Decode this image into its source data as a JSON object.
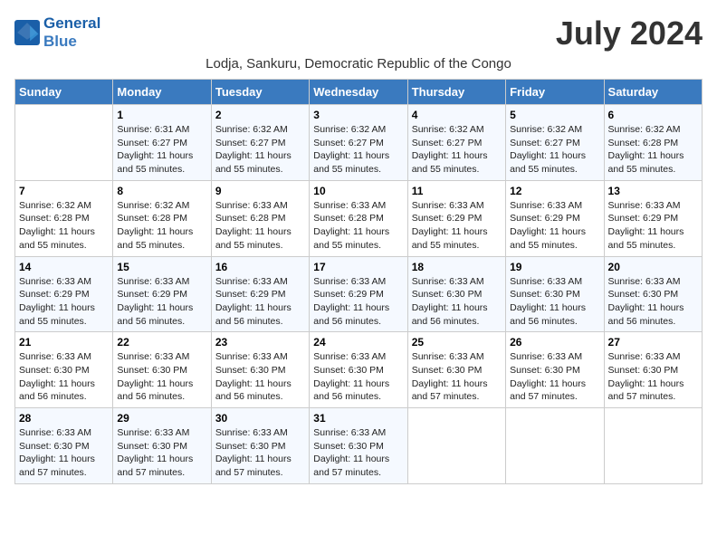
{
  "logo": {
    "line1": "General",
    "line2": "Blue"
  },
  "title": "July 2024",
  "location": "Lodja, Sankuru, Democratic Republic of the Congo",
  "days_of_week": [
    "Sunday",
    "Monday",
    "Tuesday",
    "Wednesday",
    "Thursday",
    "Friday",
    "Saturday"
  ],
  "weeks": [
    [
      {
        "day": "",
        "sunrise": "",
        "sunset": "",
        "daylight": ""
      },
      {
        "day": "1",
        "sunrise": "Sunrise: 6:31 AM",
        "sunset": "Sunset: 6:27 PM",
        "daylight": "Daylight: 11 hours and 55 minutes."
      },
      {
        "day": "2",
        "sunrise": "Sunrise: 6:32 AM",
        "sunset": "Sunset: 6:27 PM",
        "daylight": "Daylight: 11 hours and 55 minutes."
      },
      {
        "day": "3",
        "sunrise": "Sunrise: 6:32 AM",
        "sunset": "Sunset: 6:27 PM",
        "daylight": "Daylight: 11 hours and 55 minutes."
      },
      {
        "day": "4",
        "sunrise": "Sunrise: 6:32 AM",
        "sunset": "Sunset: 6:27 PM",
        "daylight": "Daylight: 11 hours and 55 minutes."
      },
      {
        "day": "5",
        "sunrise": "Sunrise: 6:32 AM",
        "sunset": "Sunset: 6:27 PM",
        "daylight": "Daylight: 11 hours and 55 minutes."
      },
      {
        "day": "6",
        "sunrise": "Sunrise: 6:32 AM",
        "sunset": "Sunset: 6:28 PM",
        "daylight": "Daylight: 11 hours and 55 minutes."
      }
    ],
    [
      {
        "day": "7",
        "sunrise": "Sunrise: 6:32 AM",
        "sunset": "Sunset: 6:28 PM",
        "daylight": "Daylight: 11 hours and 55 minutes."
      },
      {
        "day": "8",
        "sunrise": "Sunrise: 6:32 AM",
        "sunset": "Sunset: 6:28 PM",
        "daylight": "Daylight: 11 hours and 55 minutes."
      },
      {
        "day": "9",
        "sunrise": "Sunrise: 6:33 AM",
        "sunset": "Sunset: 6:28 PM",
        "daylight": "Daylight: 11 hours and 55 minutes."
      },
      {
        "day": "10",
        "sunrise": "Sunrise: 6:33 AM",
        "sunset": "Sunset: 6:28 PM",
        "daylight": "Daylight: 11 hours and 55 minutes."
      },
      {
        "day": "11",
        "sunrise": "Sunrise: 6:33 AM",
        "sunset": "Sunset: 6:29 PM",
        "daylight": "Daylight: 11 hours and 55 minutes."
      },
      {
        "day": "12",
        "sunrise": "Sunrise: 6:33 AM",
        "sunset": "Sunset: 6:29 PM",
        "daylight": "Daylight: 11 hours and 55 minutes."
      },
      {
        "day": "13",
        "sunrise": "Sunrise: 6:33 AM",
        "sunset": "Sunset: 6:29 PM",
        "daylight": "Daylight: 11 hours and 55 minutes."
      }
    ],
    [
      {
        "day": "14",
        "sunrise": "Sunrise: 6:33 AM",
        "sunset": "Sunset: 6:29 PM",
        "daylight": "Daylight: 11 hours and 55 minutes."
      },
      {
        "day": "15",
        "sunrise": "Sunrise: 6:33 AM",
        "sunset": "Sunset: 6:29 PM",
        "daylight": "Daylight: 11 hours and 56 minutes."
      },
      {
        "day": "16",
        "sunrise": "Sunrise: 6:33 AM",
        "sunset": "Sunset: 6:29 PM",
        "daylight": "Daylight: 11 hours and 56 minutes."
      },
      {
        "day": "17",
        "sunrise": "Sunrise: 6:33 AM",
        "sunset": "Sunset: 6:29 PM",
        "daylight": "Daylight: 11 hours and 56 minutes."
      },
      {
        "day": "18",
        "sunrise": "Sunrise: 6:33 AM",
        "sunset": "Sunset: 6:30 PM",
        "daylight": "Daylight: 11 hours and 56 minutes."
      },
      {
        "day": "19",
        "sunrise": "Sunrise: 6:33 AM",
        "sunset": "Sunset: 6:30 PM",
        "daylight": "Daylight: 11 hours and 56 minutes."
      },
      {
        "day": "20",
        "sunrise": "Sunrise: 6:33 AM",
        "sunset": "Sunset: 6:30 PM",
        "daylight": "Daylight: 11 hours and 56 minutes."
      }
    ],
    [
      {
        "day": "21",
        "sunrise": "Sunrise: 6:33 AM",
        "sunset": "Sunset: 6:30 PM",
        "daylight": "Daylight: 11 hours and 56 minutes."
      },
      {
        "day": "22",
        "sunrise": "Sunrise: 6:33 AM",
        "sunset": "Sunset: 6:30 PM",
        "daylight": "Daylight: 11 hours and 56 minutes."
      },
      {
        "day": "23",
        "sunrise": "Sunrise: 6:33 AM",
        "sunset": "Sunset: 6:30 PM",
        "daylight": "Daylight: 11 hours and 56 minutes."
      },
      {
        "day": "24",
        "sunrise": "Sunrise: 6:33 AM",
        "sunset": "Sunset: 6:30 PM",
        "daylight": "Daylight: 11 hours and 56 minutes."
      },
      {
        "day": "25",
        "sunrise": "Sunrise: 6:33 AM",
        "sunset": "Sunset: 6:30 PM",
        "daylight": "Daylight: 11 hours and 57 minutes."
      },
      {
        "day": "26",
        "sunrise": "Sunrise: 6:33 AM",
        "sunset": "Sunset: 6:30 PM",
        "daylight": "Daylight: 11 hours and 57 minutes."
      },
      {
        "day": "27",
        "sunrise": "Sunrise: 6:33 AM",
        "sunset": "Sunset: 6:30 PM",
        "daylight": "Daylight: 11 hours and 57 minutes."
      }
    ],
    [
      {
        "day": "28",
        "sunrise": "Sunrise: 6:33 AM",
        "sunset": "Sunset: 6:30 PM",
        "daylight": "Daylight: 11 hours and 57 minutes."
      },
      {
        "day": "29",
        "sunrise": "Sunrise: 6:33 AM",
        "sunset": "Sunset: 6:30 PM",
        "daylight": "Daylight: 11 hours and 57 minutes."
      },
      {
        "day": "30",
        "sunrise": "Sunrise: 6:33 AM",
        "sunset": "Sunset: 6:30 PM",
        "daylight": "Daylight: 11 hours and 57 minutes."
      },
      {
        "day": "31",
        "sunrise": "Sunrise: 6:33 AM",
        "sunset": "Sunset: 6:30 PM",
        "daylight": "Daylight: 11 hours and 57 minutes."
      },
      {
        "day": "",
        "sunrise": "",
        "sunset": "",
        "daylight": ""
      },
      {
        "day": "",
        "sunrise": "",
        "sunset": "",
        "daylight": ""
      },
      {
        "day": "",
        "sunrise": "",
        "sunset": "",
        "daylight": ""
      }
    ]
  ]
}
